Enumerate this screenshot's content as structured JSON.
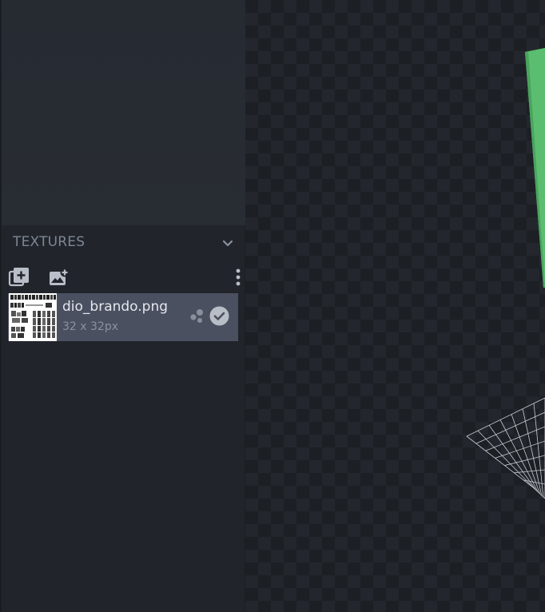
{
  "panel": {
    "title": "TEXTURES",
    "toolbar": {
      "add_icon": "add-texture-icon",
      "create_icon": "create-texture-icon",
      "menu_icon": "more-vertical-icon"
    }
  },
  "textures": [
    {
      "name": "dio_brando.png",
      "size": "32 x 32px",
      "selected": true,
      "particle_icon": "particle-icon",
      "status_icon": "check-circle-icon"
    }
  ],
  "colors": {
    "panel_bg": "#21252b",
    "item_selected_bg": "#4b5061",
    "model_green": "#5bbd6f",
    "grid_line": "#c8ccd2"
  }
}
